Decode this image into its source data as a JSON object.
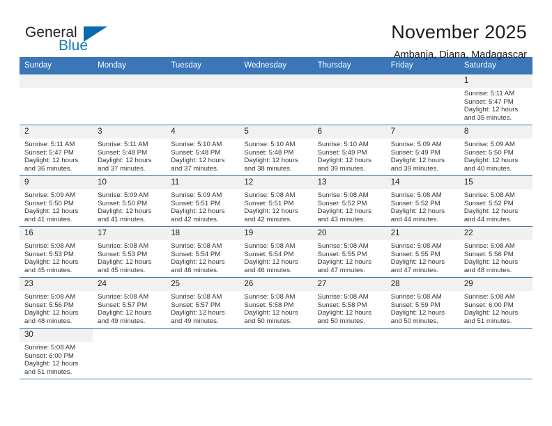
{
  "brand": {
    "line1": "General",
    "line2": "Blue",
    "triangle_color": "#0a69b0",
    "text_color": "#231f20",
    "accent_color": "#1878be"
  },
  "header": {
    "title": "November 2025",
    "subtitle": "Ambanja, Diana, Madagascar"
  },
  "theme": {
    "header_bg": "#3a76b8",
    "daynum_bg": "#f1f1f1",
    "grid_line": "#3a76b8"
  },
  "weekdays": [
    "Sunday",
    "Monday",
    "Tuesday",
    "Wednesday",
    "Thursday",
    "Friday",
    "Saturday"
  ],
  "weeks": [
    [
      {
        "day": "",
        "empty": true
      },
      {
        "day": "",
        "empty": true
      },
      {
        "day": "",
        "empty": true
      },
      {
        "day": "",
        "empty": true
      },
      {
        "day": "",
        "empty": true
      },
      {
        "day": "",
        "empty": true
      },
      {
        "day": "1",
        "sunrise": "Sunrise: 5:11 AM",
        "sunset": "Sunset: 5:47 PM",
        "daylight": "Daylight: 12 hours and 35 minutes."
      }
    ],
    [
      {
        "day": "2",
        "sunrise": "Sunrise: 5:11 AM",
        "sunset": "Sunset: 5:47 PM",
        "daylight": "Daylight: 12 hours and 36 minutes."
      },
      {
        "day": "3",
        "sunrise": "Sunrise: 5:11 AM",
        "sunset": "Sunset: 5:48 PM",
        "daylight": "Daylight: 12 hours and 37 minutes."
      },
      {
        "day": "4",
        "sunrise": "Sunrise: 5:10 AM",
        "sunset": "Sunset: 5:48 PM",
        "daylight": "Daylight: 12 hours and 37 minutes."
      },
      {
        "day": "5",
        "sunrise": "Sunrise: 5:10 AM",
        "sunset": "Sunset: 5:48 PM",
        "daylight": "Daylight: 12 hours and 38 minutes."
      },
      {
        "day": "6",
        "sunrise": "Sunrise: 5:10 AM",
        "sunset": "Sunset: 5:49 PM",
        "daylight": "Daylight: 12 hours and 39 minutes."
      },
      {
        "day": "7",
        "sunrise": "Sunrise: 5:09 AM",
        "sunset": "Sunset: 5:49 PM",
        "daylight": "Daylight: 12 hours and 39 minutes."
      },
      {
        "day": "8",
        "sunrise": "Sunrise: 5:09 AM",
        "sunset": "Sunset: 5:50 PM",
        "daylight": "Daylight: 12 hours and 40 minutes."
      }
    ],
    [
      {
        "day": "9",
        "sunrise": "Sunrise: 5:09 AM",
        "sunset": "Sunset: 5:50 PM",
        "daylight": "Daylight: 12 hours and 41 minutes."
      },
      {
        "day": "10",
        "sunrise": "Sunrise: 5:09 AM",
        "sunset": "Sunset: 5:50 PM",
        "daylight": "Daylight: 12 hours and 41 minutes."
      },
      {
        "day": "11",
        "sunrise": "Sunrise: 5:09 AM",
        "sunset": "Sunset: 5:51 PM",
        "daylight": "Daylight: 12 hours and 42 minutes."
      },
      {
        "day": "12",
        "sunrise": "Sunrise: 5:08 AM",
        "sunset": "Sunset: 5:51 PM",
        "daylight": "Daylight: 12 hours and 42 minutes."
      },
      {
        "day": "13",
        "sunrise": "Sunrise: 5:08 AM",
        "sunset": "Sunset: 5:52 PM",
        "daylight": "Daylight: 12 hours and 43 minutes."
      },
      {
        "day": "14",
        "sunrise": "Sunrise: 5:08 AM",
        "sunset": "Sunset: 5:52 PM",
        "daylight": "Daylight: 12 hours and 44 minutes."
      },
      {
        "day": "15",
        "sunrise": "Sunrise: 5:08 AM",
        "sunset": "Sunset: 5:52 PM",
        "daylight": "Daylight: 12 hours and 44 minutes."
      }
    ],
    [
      {
        "day": "16",
        "sunrise": "Sunrise: 5:08 AM",
        "sunset": "Sunset: 5:53 PM",
        "daylight": "Daylight: 12 hours and 45 minutes."
      },
      {
        "day": "17",
        "sunrise": "Sunrise: 5:08 AM",
        "sunset": "Sunset: 5:53 PM",
        "daylight": "Daylight: 12 hours and 45 minutes."
      },
      {
        "day": "18",
        "sunrise": "Sunrise: 5:08 AM",
        "sunset": "Sunset: 5:54 PM",
        "daylight": "Daylight: 12 hours and 46 minutes."
      },
      {
        "day": "19",
        "sunrise": "Sunrise: 5:08 AM",
        "sunset": "Sunset: 5:54 PM",
        "daylight": "Daylight: 12 hours and 46 minutes."
      },
      {
        "day": "20",
        "sunrise": "Sunrise: 5:08 AM",
        "sunset": "Sunset: 5:55 PM",
        "daylight": "Daylight: 12 hours and 47 minutes."
      },
      {
        "day": "21",
        "sunrise": "Sunrise: 5:08 AM",
        "sunset": "Sunset: 5:55 PM",
        "daylight": "Daylight: 12 hours and 47 minutes."
      },
      {
        "day": "22",
        "sunrise": "Sunrise: 5:08 AM",
        "sunset": "Sunset: 5:56 PM",
        "daylight": "Daylight: 12 hours and 48 minutes."
      }
    ],
    [
      {
        "day": "23",
        "sunrise": "Sunrise: 5:08 AM",
        "sunset": "Sunset: 5:56 PM",
        "daylight": "Daylight: 12 hours and 48 minutes."
      },
      {
        "day": "24",
        "sunrise": "Sunrise: 5:08 AM",
        "sunset": "Sunset: 5:57 PM",
        "daylight": "Daylight: 12 hours and 49 minutes."
      },
      {
        "day": "25",
        "sunrise": "Sunrise: 5:08 AM",
        "sunset": "Sunset: 5:57 PM",
        "daylight": "Daylight: 12 hours and 49 minutes."
      },
      {
        "day": "26",
        "sunrise": "Sunrise: 5:08 AM",
        "sunset": "Sunset: 5:58 PM",
        "daylight": "Daylight: 12 hours and 50 minutes."
      },
      {
        "day": "27",
        "sunrise": "Sunrise: 5:08 AM",
        "sunset": "Sunset: 5:58 PM",
        "daylight": "Daylight: 12 hours and 50 minutes."
      },
      {
        "day": "28",
        "sunrise": "Sunrise: 5:08 AM",
        "sunset": "Sunset: 5:59 PM",
        "daylight": "Daylight: 12 hours and 50 minutes."
      },
      {
        "day": "29",
        "sunrise": "Sunrise: 5:08 AM",
        "sunset": "Sunset: 6:00 PM",
        "daylight": "Daylight: 12 hours and 51 minutes."
      }
    ],
    [
      {
        "day": "30",
        "sunrise": "Sunrise: 5:08 AM",
        "sunset": "Sunset: 6:00 PM",
        "daylight": "Daylight: 12 hours and 51 minutes."
      },
      {
        "day": "",
        "empty": true,
        "trailing": true
      },
      {
        "day": "",
        "empty": true,
        "trailing": true
      },
      {
        "day": "",
        "empty": true,
        "trailing": true
      },
      {
        "day": "",
        "empty": true,
        "trailing": true
      },
      {
        "day": "",
        "empty": true,
        "trailing": true
      },
      {
        "day": "",
        "empty": true,
        "trailing": true
      }
    ]
  ]
}
